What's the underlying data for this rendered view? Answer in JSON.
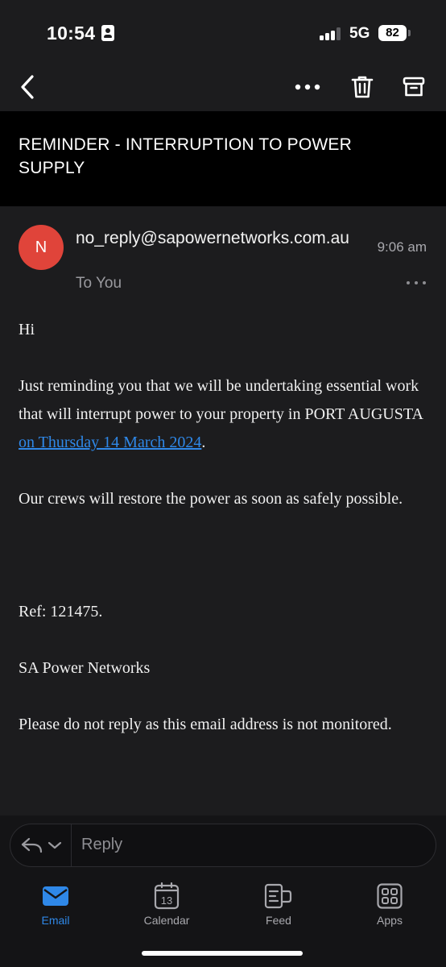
{
  "status_bar": {
    "time": "10:54",
    "network": "5G",
    "battery": "82",
    "focus_icon": "person-card-icon"
  },
  "toolbar": {
    "back_icon": "chevron-left-icon",
    "more_icon": "more-horizontal-icon",
    "delete_icon": "trash-icon",
    "archive_icon": "archive-icon"
  },
  "email": {
    "subject": "REMINDER - INTERRUPTION TO POWER SUPPLY",
    "avatar_initial": "N",
    "avatar_color": "#e0443a",
    "sender": "no_reply@sapowernetworks.com.au",
    "recipient": "To You",
    "time": "9:06 am",
    "body": {
      "greeting": "Hi",
      "para1_before": "Just reminding you that we will be undertaking essential work that will interrupt power to your property in PORT AUGUSTA ",
      "para1_link": "on Thursday 14 March 2024",
      "para1_after": ".",
      "para2": "Our crews will restore the power as soon as safely possible.",
      "ref": "Ref: 121475.",
      "signature": "SA Power Networks",
      "footer": "Please do not reply as this email address is not monitored."
    }
  },
  "reply": {
    "placeholder": "Reply"
  },
  "tabs": [
    {
      "label": "Email",
      "icon": "envelope-icon",
      "active": true
    },
    {
      "label": "Calendar",
      "icon": "calendar-icon",
      "badge": "13",
      "active": false
    },
    {
      "label": "Feed",
      "icon": "feed-icon",
      "active": false
    },
    {
      "label": "Apps",
      "icon": "apps-grid-icon",
      "active": false
    }
  ],
  "colors": {
    "accent": "#2f88e8",
    "background": "#1c1c1e",
    "subject_background": "#000000"
  }
}
